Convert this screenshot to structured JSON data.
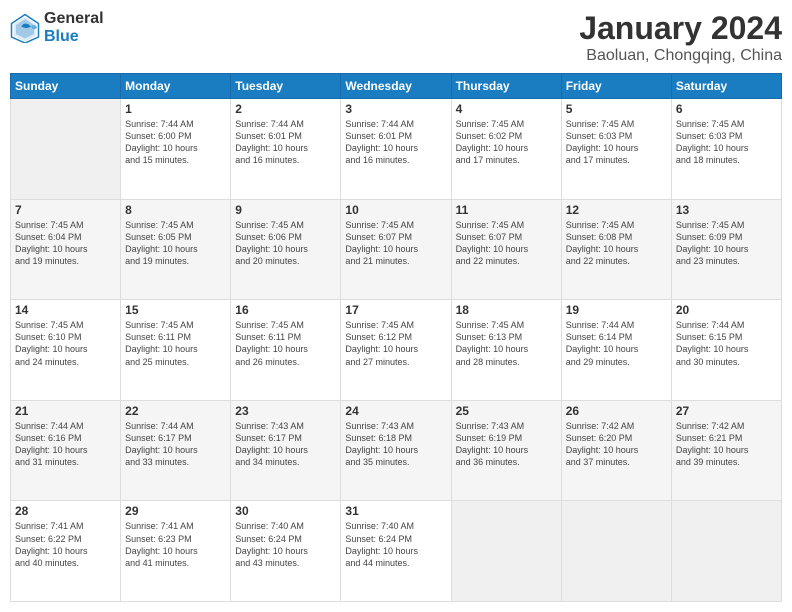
{
  "logo": {
    "line1": "General",
    "line2": "Blue"
  },
  "title": "January 2024",
  "subtitle": "Baoluan, Chongqing, China",
  "headers": [
    "Sunday",
    "Monday",
    "Tuesday",
    "Wednesday",
    "Thursday",
    "Friday",
    "Saturday"
  ],
  "weeks": [
    [
      {
        "day": "",
        "info": ""
      },
      {
        "day": "1",
        "info": "Sunrise: 7:44 AM\nSunset: 6:00 PM\nDaylight: 10 hours\nand 15 minutes."
      },
      {
        "day": "2",
        "info": "Sunrise: 7:44 AM\nSunset: 6:01 PM\nDaylight: 10 hours\nand 16 minutes."
      },
      {
        "day": "3",
        "info": "Sunrise: 7:44 AM\nSunset: 6:01 PM\nDaylight: 10 hours\nand 16 minutes."
      },
      {
        "day": "4",
        "info": "Sunrise: 7:45 AM\nSunset: 6:02 PM\nDaylight: 10 hours\nand 17 minutes."
      },
      {
        "day": "5",
        "info": "Sunrise: 7:45 AM\nSunset: 6:03 PM\nDaylight: 10 hours\nand 17 minutes."
      },
      {
        "day": "6",
        "info": "Sunrise: 7:45 AM\nSunset: 6:03 PM\nDaylight: 10 hours\nand 18 minutes."
      }
    ],
    [
      {
        "day": "7",
        "info": "Sunrise: 7:45 AM\nSunset: 6:04 PM\nDaylight: 10 hours\nand 19 minutes."
      },
      {
        "day": "8",
        "info": "Sunrise: 7:45 AM\nSunset: 6:05 PM\nDaylight: 10 hours\nand 19 minutes."
      },
      {
        "day": "9",
        "info": "Sunrise: 7:45 AM\nSunset: 6:06 PM\nDaylight: 10 hours\nand 20 minutes."
      },
      {
        "day": "10",
        "info": "Sunrise: 7:45 AM\nSunset: 6:07 PM\nDaylight: 10 hours\nand 21 minutes."
      },
      {
        "day": "11",
        "info": "Sunrise: 7:45 AM\nSunset: 6:07 PM\nDaylight: 10 hours\nand 22 minutes."
      },
      {
        "day": "12",
        "info": "Sunrise: 7:45 AM\nSunset: 6:08 PM\nDaylight: 10 hours\nand 22 minutes."
      },
      {
        "day": "13",
        "info": "Sunrise: 7:45 AM\nSunset: 6:09 PM\nDaylight: 10 hours\nand 23 minutes."
      }
    ],
    [
      {
        "day": "14",
        "info": "Sunrise: 7:45 AM\nSunset: 6:10 PM\nDaylight: 10 hours\nand 24 minutes."
      },
      {
        "day": "15",
        "info": "Sunrise: 7:45 AM\nSunset: 6:11 PM\nDaylight: 10 hours\nand 25 minutes."
      },
      {
        "day": "16",
        "info": "Sunrise: 7:45 AM\nSunset: 6:11 PM\nDaylight: 10 hours\nand 26 minutes."
      },
      {
        "day": "17",
        "info": "Sunrise: 7:45 AM\nSunset: 6:12 PM\nDaylight: 10 hours\nand 27 minutes."
      },
      {
        "day": "18",
        "info": "Sunrise: 7:45 AM\nSunset: 6:13 PM\nDaylight: 10 hours\nand 28 minutes."
      },
      {
        "day": "19",
        "info": "Sunrise: 7:44 AM\nSunset: 6:14 PM\nDaylight: 10 hours\nand 29 minutes."
      },
      {
        "day": "20",
        "info": "Sunrise: 7:44 AM\nSunset: 6:15 PM\nDaylight: 10 hours\nand 30 minutes."
      }
    ],
    [
      {
        "day": "21",
        "info": "Sunrise: 7:44 AM\nSunset: 6:16 PM\nDaylight: 10 hours\nand 31 minutes."
      },
      {
        "day": "22",
        "info": "Sunrise: 7:44 AM\nSunset: 6:17 PM\nDaylight: 10 hours\nand 33 minutes."
      },
      {
        "day": "23",
        "info": "Sunrise: 7:43 AM\nSunset: 6:17 PM\nDaylight: 10 hours\nand 34 minutes."
      },
      {
        "day": "24",
        "info": "Sunrise: 7:43 AM\nSunset: 6:18 PM\nDaylight: 10 hours\nand 35 minutes."
      },
      {
        "day": "25",
        "info": "Sunrise: 7:43 AM\nSunset: 6:19 PM\nDaylight: 10 hours\nand 36 minutes."
      },
      {
        "day": "26",
        "info": "Sunrise: 7:42 AM\nSunset: 6:20 PM\nDaylight: 10 hours\nand 37 minutes."
      },
      {
        "day": "27",
        "info": "Sunrise: 7:42 AM\nSunset: 6:21 PM\nDaylight: 10 hours\nand 39 minutes."
      }
    ],
    [
      {
        "day": "28",
        "info": "Sunrise: 7:41 AM\nSunset: 6:22 PM\nDaylight: 10 hours\nand 40 minutes."
      },
      {
        "day": "29",
        "info": "Sunrise: 7:41 AM\nSunset: 6:23 PM\nDaylight: 10 hours\nand 41 minutes."
      },
      {
        "day": "30",
        "info": "Sunrise: 7:40 AM\nSunset: 6:24 PM\nDaylight: 10 hours\nand 43 minutes."
      },
      {
        "day": "31",
        "info": "Sunrise: 7:40 AM\nSunset: 6:24 PM\nDaylight: 10 hours\nand 44 minutes."
      },
      {
        "day": "",
        "info": ""
      },
      {
        "day": "",
        "info": ""
      },
      {
        "day": "",
        "info": ""
      }
    ]
  ]
}
